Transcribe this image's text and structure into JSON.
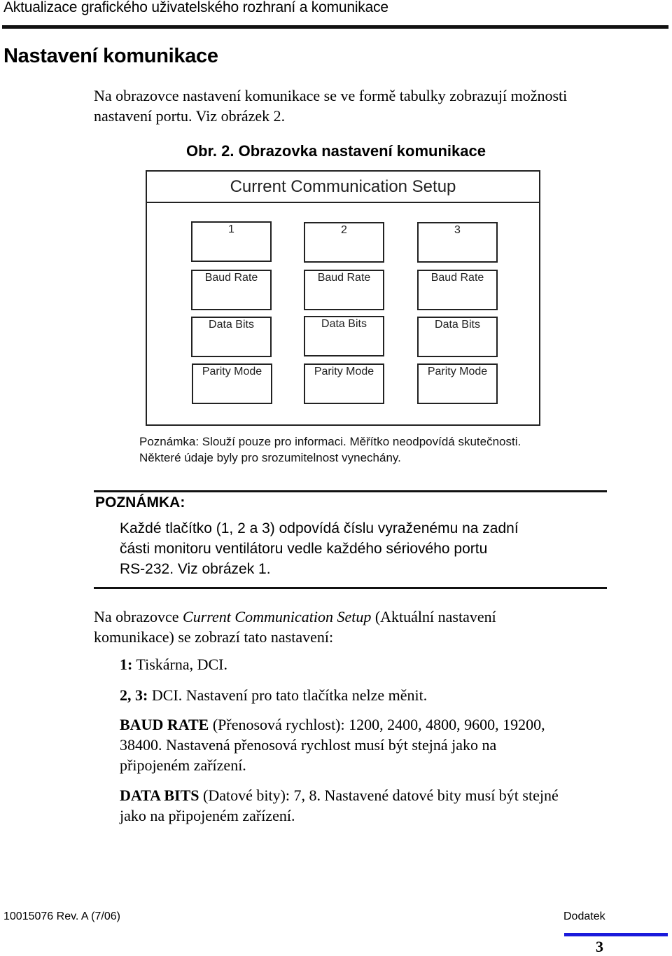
{
  "header": {
    "running_title": "Aktualizace grafického uživatelského rozhraní a komunikace"
  },
  "section": {
    "title": "Nastavení komunikace"
  },
  "intro": {
    "lines": [
      "Na obrazovce nastavení komunikace se ve formě tabulky zobrazují možnosti",
      "nastavení portu. Viz obrázek 2."
    ]
  },
  "figure": {
    "caption": "Obr. 2. Obrazovka nastavení komunikace",
    "screen_title": "Current Communication Setup",
    "columns": [
      {
        "port": "1",
        "baud": "Baud Rate",
        "data_bits": "Data Bits",
        "parity": "Parity Mode"
      },
      {
        "port": "2",
        "baud": "Baud Rate",
        "data_bits": "Data Bits",
        "parity": "Parity Mode"
      },
      {
        "port": "3",
        "baud": "Baud Rate",
        "data_bits": "Data Bits",
        "parity": "Parity Mode"
      }
    ],
    "note_lines": [
      "Poznámka: Slouží pouze pro informaci. Měřítko neodpovídá skutečnosti.",
      "Některé údaje byly pro srozumitelnost vynechány."
    ]
  },
  "note": {
    "heading": "POZNÁMKA:",
    "lines": [
      "Každé tlačítko (1, 2 a 3) odpovídá číslu vyraženému na zadní",
      "části monitoru ventilátoru vedle každého sériového portu",
      "RS-232. Viz obrázek 1."
    ]
  },
  "para2": {
    "prefix": "Na obrazovce ",
    "italic": "Current Communication Setup",
    "suffix": " (Aktuální nastavení",
    "line2": "komunikace) se zobrazí tato nastavení:"
  },
  "items": {
    "port1": {
      "label": "1:",
      "text": " Tiskárna, DCI."
    },
    "port23": {
      "label": "2, 3:",
      "text": " DCI. Nastavení pro tato tlačítka nelze měnit."
    },
    "baud": {
      "label": "BAUD RATE",
      "line1": " (Přenosová rychlost): 1200, 2400, 4800, 9600, 19200,",
      "line2": "38400. Nastavená přenosová rychlost musí být stejná jako na",
      "line3": "připojeném zařízení."
    },
    "data_bits": {
      "label": "DATA BITS",
      "line1": " (Datové bity): 7, 8. Nastavené datové bity musí být stejné",
      "line2": "jako na připojeném zařízení."
    }
  },
  "footer": {
    "doc_id": "10015076 Rev. A (7/06)",
    "section": "Dodatek",
    "page_number": "3",
    "accent_color": "#1a1adb"
  }
}
